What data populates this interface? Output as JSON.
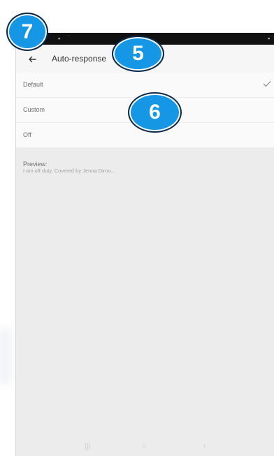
{
  "app_bar": {
    "title": "Auto-response"
  },
  "options": [
    {
      "label": "Default",
      "selected": true
    },
    {
      "label": "Custom",
      "selected": false
    },
    {
      "label": "Off",
      "selected": false
    }
  ],
  "preview": {
    "title": "Preview:",
    "text": "I am off duty. Covered by Jenna Dirno..."
  },
  "nav": {
    "recents": "|||",
    "home": "○",
    "back": "‹"
  },
  "callouts": {
    "a": "7",
    "b": "5",
    "c": "6"
  },
  "colors": {
    "callout": "#1597e5",
    "callout_border": "#0b2a4a",
    "status_bar": "#111111",
    "app_bar": "#f6f6f6",
    "background": "#ececec"
  },
  "icons": {
    "back": "arrow-left-icon",
    "check": "checkmark-icon"
  }
}
